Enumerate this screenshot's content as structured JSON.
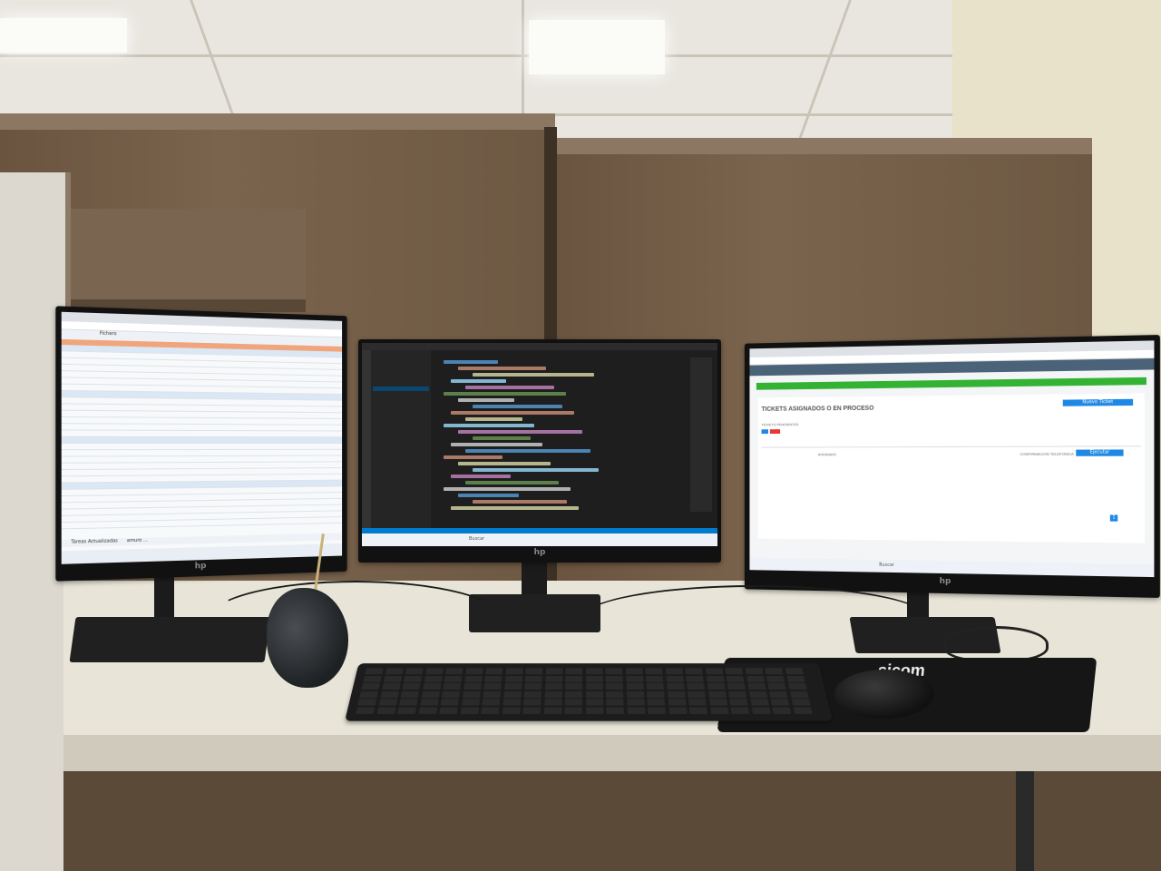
{
  "scene": "Office cubicle desk with three monitors, keyboard, mouse and mate cup",
  "left_monitor": {
    "app": "spreadsheet",
    "tab_label": "Fichero",
    "sheet_tabs": [
      "Tareas Actualizadas",
      "amuro ..."
    ]
  },
  "center_monitor": {
    "app": "code-editor",
    "search_placeholder": "Buscar"
  },
  "right_monitor": {
    "app": "web-ticketing",
    "title": "TICKETS ASIGNADOS O EN PROCESO",
    "new_ticket_button": "Nuevo Ticket",
    "section_label": "TICKETS PENDIENTES",
    "row_status": "ASIGNADO",
    "row_detail": "CONFIRMACION TELEFONICA",
    "action_button": "Ejecutar",
    "page_number": "1",
    "search_placeholder": "Buscar"
  },
  "mousepad_brand": "sicom",
  "monitor_brand": "hp",
  "colors": {
    "green_banner": "#34b233",
    "accent_blue": "#1e88e5",
    "code_bg": "#1e1e1e"
  }
}
